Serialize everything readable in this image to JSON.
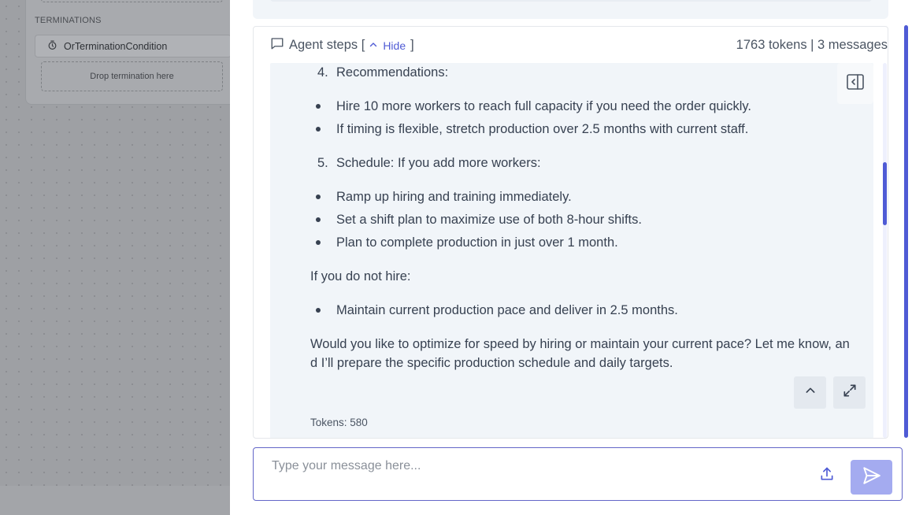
{
  "canvas": {
    "terminations_title": "TERMINATIONS",
    "condition_label": "OrTerminationCondition",
    "drop_placeholder": "Drop termination here"
  },
  "agent_steps": {
    "label": "Agent steps [",
    "hide_label": "Hide",
    "bracket_close": "]",
    "summary": "1763 tokens | 3 messages"
  },
  "message": {
    "items": [
      {
        "type": "ol",
        "num": "4.",
        "text": "Recommendations:"
      },
      {
        "type": "bullet",
        "text": "Hire 10 more workers to reach full capacity if you need the order quickly."
      },
      {
        "type": "bullet",
        "text": "If timing is flexible, stretch production over 2.5 months with current staff."
      },
      {
        "type": "ol",
        "num": "5.",
        "text": "Schedule: If you add more workers:"
      },
      {
        "type": "bullet",
        "text": "Ramp up hiring and training immediately."
      },
      {
        "type": "bullet",
        "text": "Set a shift plan to maximize use of both 8-hour shifts."
      },
      {
        "type": "bullet",
        "text": "Plan to complete production in just over 1 month."
      },
      {
        "type": "para",
        "text": "If you do not hire:"
      },
      {
        "type": "bullet",
        "text": "Maintain current production pace and deliver in 2.5 months."
      },
      {
        "type": "para",
        "text": "Would you like to optimize for speed by hiring or maintain your current pace? Let me know, an"
      },
      {
        "type": "para",
        "text": "d I’ll prepare the specific production schedule and daily targets."
      }
    ],
    "tokens": "Tokens: 580"
  },
  "composer": {
    "placeholder": "Type your message here..."
  },
  "icons": {
    "chat": "message-square-icon",
    "hide": "chevron-up-icon",
    "sidebar": "panel-left-close-icon",
    "collapse": "chevron-up-icon",
    "expand": "maximize-icon",
    "upload": "upload-icon",
    "send": "send-icon",
    "timer": "timer-icon"
  },
  "colors": {
    "accent": "#4f5bd5",
    "send_disabled": "#a4abf0",
    "bubble": "#f1f5f9"
  }
}
